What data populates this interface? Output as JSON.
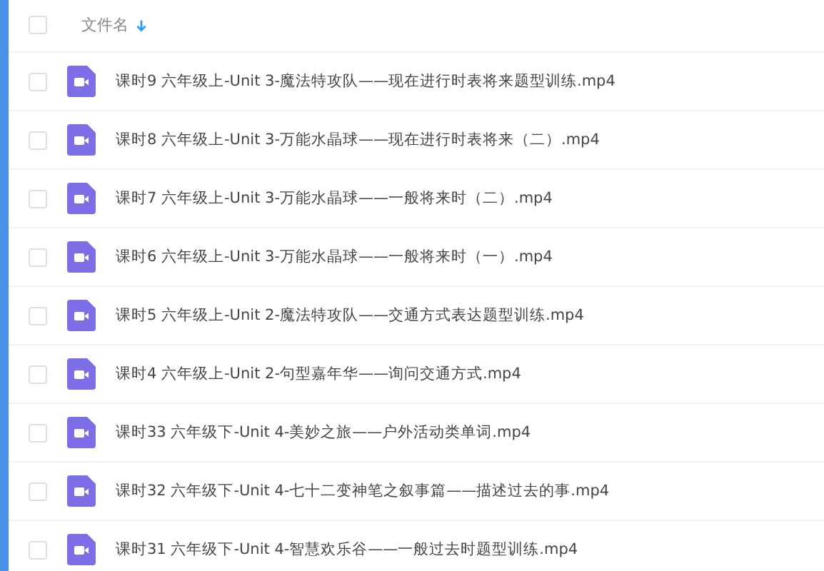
{
  "header": {
    "label": "文件名",
    "sorted_descending": true,
    "checked": false
  },
  "files": [
    {
      "name": "课时9 六年级上-Unit 3-魔法特攻队——现在进行时表将来题型训练.mp4",
      "checked": false
    },
    {
      "name": "课时8 六年级上-Unit 3-万能水晶球——现在进行时表将来（二）.mp4",
      "checked": false
    },
    {
      "name": "课时7 六年级上-Unit 3-万能水晶球——一般将来时（二）.mp4",
      "checked": false
    },
    {
      "name": "课时6 六年级上-Unit 3-万能水晶球——一般将来时（一）.mp4",
      "checked": false
    },
    {
      "name": "课时5 六年级上-Unit 2-魔法特攻队——交通方式表达题型训练.mp4",
      "checked": false
    },
    {
      "name": "课时4 六年级上-Unit 2-句型嘉年华——询问交通方式.mp4",
      "checked": false
    },
    {
      "name": "课时33 六年级下-Unit 4-美妙之旅——户外活动类单词.mp4",
      "checked": false
    },
    {
      "name": "课时32 六年级下-Unit 4-七十二变神笔之叙事篇——描述过去的事.mp4",
      "checked": false
    },
    {
      "name": "课时31 六年级下-Unit 4-智慧欢乐谷——一般过去时题型训练.mp4",
      "checked": false
    }
  ]
}
